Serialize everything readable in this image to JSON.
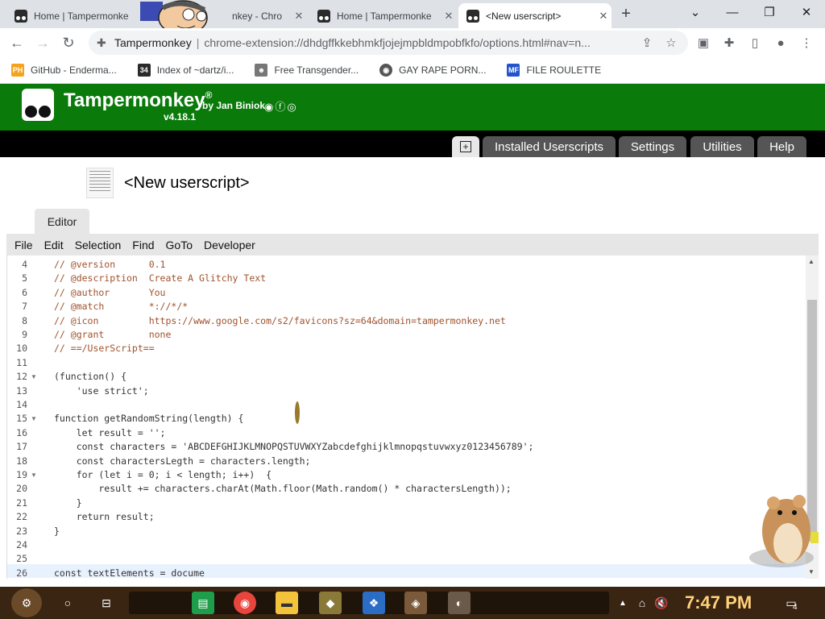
{
  "browser": {
    "tabs": [
      {
        "title": "Home | Tampermonke",
        "active": false
      },
      {
        "title": "nkey - Chro",
        "active": false
      },
      {
        "title": "Home | Tampermonke",
        "active": false
      },
      {
        "title": "<New userscript>",
        "active": true
      }
    ],
    "new_tab": "+",
    "window_controls": {
      "minimize": "—",
      "restore": "❐",
      "close": "✕",
      "dropdown": "⌄"
    },
    "address": {
      "site": "Tampermonkey",
      "separator": "|",
      "url": "chrome-extension://dhdgffkkebhmkfjojejmpbldmpobfkfo/options.html#nav=n..."
    },
    "bookmarks": [
      {
        "label": "GitHub - Enderma...",
        "icon": "PH",
        "color": "#f7a21b"
      },
      {
        "label": "Index of ~dartz/i...",
        "icon": "34",
        "color": "#2a2a2a"
      },
      {
        "label": "Free Transgender...",
        "icon": "☻",
        "color": "#777777"
      },
      {
        "label": "GAY RAPE PORN...",
        "icon": "◉",
        "color": "#555555"
      },
      {
        "label": "FILE ROULETTE",
        "icon": "MF",
        "color": "#2255cc"
      }
    ]
  },
  "tampermonkey": {
    "name": "Tampermonkey",
    "reg": "®",
    "by": "by Jan Biniok",
    "version": "v4.18.1",
    "nav": {
      "add_icon": "+",
      "installed": "Installed Userscripts",
      "settings": "Settings",
      "utilities": "Utilities",
      "help": "Help"
    },
    "script_title": "<New userscript>",
    "editor_tab": "Editor",
    "menu": [
      "File",
      "Edit",
      "Selection",
      "Find",
      "GoTo",
      "Developer"
    ]
  },
  "code": {
    "lines": [
      {
        "n": "4",
        "text": "// @version      0.1"
      },
      {
        "n": "5",
        "text": "// @description  Create A Glitchy Text"
      },
      {
        "n": "6",
        "text": "// @author       You"
      },
      {
        "n": "7",
        "text": "// @match        *://*/*"
      },
      {
        "n": "8",
        "text": "// @icon         https://www.google.com/s2/favicons?sz=64&domain=tampermonkey.net"
      },
      {
        "n": "9",
        "text": "// @grant        none"
      },
      {
        "n": "10",
        "text": "// ==/UserScript=="
      },
      {
        "n": "11",
        "text": ""
      },
      {
        "n": "12",
        "text": "(function() {"
      },
      {
        "n": "13",
        "text": "    'use strict';"
      },
      {
        "n": "14",
        "text": ""
      },
      {
        "n": "15",
        "text": "function getRandomString(length) {"
      },
      {
        "n": "16",
        "text": "    let result = '';"
      },
      {
        "n": "17",
        "text": "    const characters = 'ABCDEFGHIJKLMNOPQSTUVWXYZabcdefghijklmnopqstuvwxyz0123456789';"
      },
      {
        "n": "18",
        "text": "    const charactersLegth = characters.length;"
      },
      {
        "n": "19",
        "text": "    for (let i = 0; i < length; i++)  {"
      },
      {
        "n": "20",
        "text": "        result += characters.charAt(Math.floor(Math.random() * charactersLength));"
      },
      {
        "n": "21",
        "text": "    }"
      },
      {
        "n": "22",
        "text": "    return result;"
      },
      {
        "n": "23",
        "text": "}"
      },
      {
        "n": "24",
        "text": ""
      },
      {
        "n": "25",
        "text": ""
      },
      {
        "n": "26",
        "text": "const textElements = docume"
      }
    ]
  },
  "taskbar": {
    "clock": "7:47 PM",
    "notifications": "4"
  }
}
